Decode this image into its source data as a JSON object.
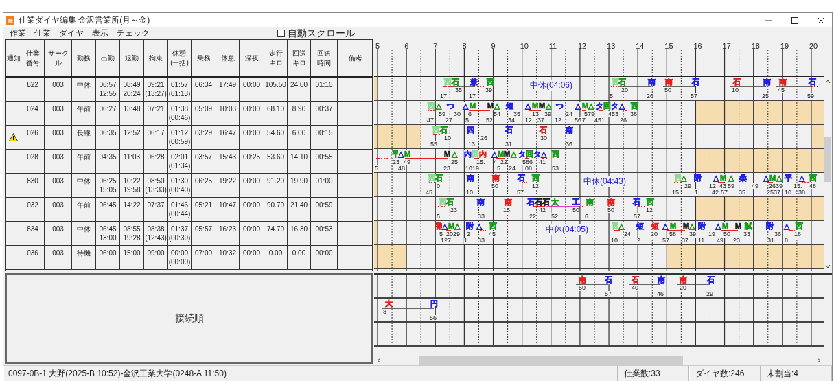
{
  "window": {
    "title": "仕業ダイヤ編集 金沢営業所(月～金)"
  },
  "menu": [
    "作業",
    "仕業",
    "ダイヤ",
    "表示",
    "チェック"
  ],
  "auto_scroll": {
    "label": "自動スクロール",
    "checked": false
  },
  "table": {
    "notice_column": "通知",
    "columns": [
      "仕業番号",
      "サークル",
      "勤務",
      "出勤",
      "退勤",
      "拘束",
      "休憩\n(一括)",
      "乗務",
      "休息",
      "深夜",
      "走行キロ",
      "回送キロ",
      "回送時間",
      "備考"
    ],
    "rows": [
      {
        "warning": false,
        "cells": [
          "822",
          "003",
          "中休",
          "06:57\n12:55",
          "08:49\n20:24",
          "09:21\n(13:27)",
          "01:57\n(01:13)",
          "06:34",
          "17:49",
          "00:00",
          "105.50",
          "24.00",
          "01:10"
        ]
      },
      {
        "warning": false,
        "cells": [
          "024",
          "003",
          "午前",
          "06:27",
          "13:48",
          "07:21",
          "01:38\n(00:46)",
          "05:09",
          "10:03",
          "00:00",
          "68.10",
          "8.90",
          "00:37"
        ]
      },
      {
        "warning": true,
        "cells": [
          "026",
          "003",
          "長線",
          "06:35",
          "12:52",
          "06:17",
          "01:12\n(00:59)",
          "03:29",
          "16:47",
          "00:00",
          "54.60",
          "6.00",
          "00:15"
        ]
      },
      {
        "warning": false,
        "cells": [
          "028",
          "003",
          "午前",
          "04:35",
          "11:03",
          "06:28",
          "02:01\n(01:34)",
          "03:57",
          "15:43",
          "00:25",
          "53.60",
          "14.10",
          "00:55"
        ]
      },
      {
        "warning": false,
        "cells": [
          "830",
          "003",
          "中休",
          "06:25\n15:05",
          "10:22\n19:58",
          "08:50\n(13:33)",
          "01:30\n(00:40)",
          "06:25",
          "19:22",
          "00:00",
          "91.20",
          "19.90",
          "01:00"
        ]
      },
      {
        "warning": false,
        "cells": [
          "032",
          "003",
          "午前",
          "06:45",
          "14:22",
          "07:37",
          "01:46\n(00:44)",
          "05:21",
          "10:47",
          "00:00",
          "90.70",
          "21.40",
          "00:59"
        ]
      },
      {
        "warning": false,
        "cells": [
          "834",
          "003",
          "中休",
          "06:45\n13:00",
          "08:55\n19:28",
          "08:38\n(12:43)",
          "01:37\n(00:39)",
          "05:57",
          "16:23",
          "00:00",
          "74.70",
          "16.30",
          "00:53"
        ]
      },
      {
        "warning": false,
        "cells": [
          "036",
          "003",
          "待機",
          "06:00",
          "15:00",
          "09:00",
          "00:00\n(00:00)",
          "07:00",
          "10:32",
          "00:00",
          "0.00",
          "0.00",
          "00:00"
        ]
      }
    ]
  },
  "timeline": {
    "hours": [
      "5",
      "6",
      "7",
      "8",
      "9",
      "10",
      "11",
      "12",
      "13",
      "14",
      "15",
      "16",
      "17",
      "18",
      "19",
      "20"
    ],
    "rows": [
      {
        "break_label": "中休(04:06)",
        "marks": [
          {
            "text": "西",
            "color": "#8fd88f"
          },
          {
            "text": "石",
            "color": "#1a9a1a"
          },
          {
            "text": "兼",
            "color": "#1f1fe0"
          },
          {
            "text": "西",
            "color": "#1a9a1a"
          },
          {
            "text": "西",
            "color": "#8fd88f"
          },
          {
            "text": "石",
            "color": "#1a9a1a"
          },
          {
            "text": "南",
            "color": "#1f1fe0"
          },
          {
            "text": "南",
            "color": "#e01f1f"
          },
          {
            "text": "石",
            "color": "#1f1fe0"
          },
          {
            "text": "石",
            "color": "#e01f1f"
          },
          {
            "text": "南",
            "color": "#1f1fe0"
          },
          {
            "text": "南",
            "color": "#e01f1f"
          },
          {
            "text": "石",
            "color": "#1f1fe0"
          }
        ],
        "numbers": [
          "35",
          "39",
          "20",
          "50",
          "10",
          "45"
        ],
        "numbers_lower": [
          "17",
          "17",
          "5",
          "26",
          "57",
          "25",
          "59"
        ]
      },
      {
        "marks": [
          {
            "text": "西",
            "color": "#8fd88f"
          },
          {
            "text": "△",
            "color": "#1a9a1a"
          },
          {
            "text": "つ",
            "color": "#1f1fe0"
          },
          {
            "text": "△",
            "color": "#1f1fe0"
          },
          {
            "text": "M",
            "color": "#1a9a1a"
          },
          {
            "text": "M",
            "color": "#202020"
          },
          {
            "text": "△",
            "color": "#1a9a1a"
          },
          {
            "text": "短",
            "color": "#1f1fe0"
          },
          {
            "text": "△",
            "color": "#1f1fe0"
          },
          {
            "text": "M",
            "color": "#1a9a1a"
          },
          {
            "text": "M",
            "color": "#202020"
          },
          {
            "text": "△",
            "color": "#1a9a1a"
          },
          {
            "text": "つ",
            "color": "#1f1fe0"
          },
          {
            "text": "△",
            "color": "#1f1fe0"
          },
          {
            "text": "M",
            "color": "#1a9a1a"
          },
          {
            "text": "△",
            "color": "#1a9a1a"
          },
          {
            "text": "タ",
            "color": "#1f1fe0"
          },
          {
            "text": "回",
            "color": "#1a9a1a"
          },
          {
            "text": "タ",
            "color": "#1f1fe0"
          },
          {
            "text": "△",
            "color": "#1f1fe0"
          },
          {
            "text": "西",
            "color": "#1a9a1a"
          }
        ],
        "numbers": [
          "59",
          "30",
          "6",
          "54",
          "35",
          "13",
          "39",
          "24",
          "579",
          "453",
          "38"
        ],
        "numbers_lower": [
          "47",
          "27",
          "5",
          "52",
          "34",
          "12",
          "37",
          "12",
          "56",
          "7",
          "451",
          "26"
        ]
      },
      {
        "marks": [
          {
            "text": "西",
            "color": "#8fd88f"
          },
          {
            "text": "石",
            "color": "#1a9a1a"
          },
          {
            "text": "四",
            "color": "#1f1fe0"
          },
          {
            "text": "石",
            "color": "#1f1fe0"
          },
          {
            "text": "石",
            "color": "#e01f1f"
          },
          {
            "text": "南",
            "color": "#1f1fe0"
          }
        ],
        "numbers": [
          "10",
          "26",
          "30"
        ],
        "numbers_lower": [
          "55",
          "13",
          "31",
          "36"
        ]
      },
      {
        "marks": [
          {
            "text": "平",
            "color": "#1a9a1a"
          },
          {
            "text": "△",
            "color": "#1f1fe0"
          },
          {
            "text": "M",
            "color": "#1a9a1a"
          },
          {
            "text": "M",
            "color": "#202020"
          },
          {
            "text": "△",
            "color": "#1a9a1a"
          },
          {
            "text": "内",
            "color": "#1f1fe0"
          },
          {
            "text": "回",
            "color": "#8fd88f"
          },
          {
            "text": "内",
            "color": "#e01f1f"
          },
          {
            "text": "△",
            "color": "#1f1fe0"
          },
          {
            "text": "M",
            "color": "#1a9a1a"
          },
          {
            "text": "M",
            "color": "#202020"
          },
          {
            "text": "△",
            "color": "#1a9a1a"
          },
          {
            "text": "タ",
            "color": "#1f1fe0"
          },
          {
            "text": "回",
            "color": "#1a9a1a"
          },
          {
            "text": "タ",
            "color": "#1f1fe0"
          },
          {
            "text": "△",
            "color": "#1f1fe0"
          },
          {
            "text": "西",
            "color": "#1a9a1a"
          }
        ],
        "numbers": [
          "23",
          "49",
          "25",
          "15:",
          "4",
          "22",
          "586",
          "41"
        ],
        "numbers_lower": [
          "5",
          "48",
          "23",
          "1019",
          "5",
          "24",
          "08",
          "53"
        ]
      },
      {
        "break_label": "中休(04:43)",
        "marks": [
          {
            "text": "西",
            "color": "#8fd88f"
          },
          {
            "text": "石",
            "color": "#1a9a1a"
          },
          {
            "text": "南",
            "color": "#1f1fe0"
          },
          {
            "text": "南",
            "color": "#e01f1f"
          },
          {
            "text": "石",
            "color": "#1f1fe0"
          },
          {
            "text": "西",
            "color": "#1a9a1a"
          },
          {
            "text": "西",
            "color": "#8fd88f"
          },
          {
            "text": "△",
            "color": "#1a9a1a"
          },
          {
            "text": "附",
            "color": "#1f1fe0"
          },
          {
            "text": "△",
            "color": "#1f1fe0"
          },
          {
            "text": "M",
            "color": "#1a9a1a"
          },
          {
            "text": "△",
            "color": "#1a9a1a"
          },
          {
            "text": "桑",
            "color": "#1f1fe0"
          },
          {
            "text": "△",
            "color": "#1f1fe0"
          },
          {
            "text": "M",
            "color": "#1a9a1a"
          },
          {
            "text": "△",
            "color": "#1a9a1a"
          },
          {
            "text": "平",
            "color": "#1f1fe0"
          },
          {
            "text": "△",
            "color": "#1f1fe0"
          },
          {
            "text": "西",
            "color": "#1a9a1a"
          }
        ],
        "numbers": [
          "0",
          "50",
          "12",
          "29",
          "12",
          "43",
          "59",
          "49",
          "2639",
          "15:",
          "48"
        ],
        "numbers_lower": [
          "45",
          "10",
          "57",
          "15",
          "1",
          "42",
          "57",
          "35",
          "2537",
          "10",
          "38"
        ]
      },
      {
        "marks": [
          {
            "text": "西",
            "color": "#8fd88f"
          },
          {
            "text": "石",
            "color": "#1a9a1a"
          },
          {
            "text": "南",
            "color": "#1f1fe0"
          },
          {
            "text": "南",
            "color": "#e01f1f"
          },
          {
            "text": "石",
            "color": "#1f1fe0"
          },
          {
            "text": "石",
            "color": "#202020"
          },
          {
            "text": "石",
            "color": "#202020"
          },
          {
            "text": "太",
            "color": "#1a9a1a"
          },
          {
            "text": "工",
            "color": "#1f1fe0"
          },
          {
            "text": "南",
            "color": "#1a9a1a"
          },
          {
            "text": "南",
            "color": "#e01f1f"
          },
          {
            "text": "石",
            "color": "#1f1fe0"
          },
          {
            "text": "西",
            "color": "#1a9a1a"
          }
        ],
        "numbers": [
          "23",
          "15:",
          "42",
          "50",
          "50",
          "12"
        ],
        "numbers_lower": [
          "5",
          "33",
          "22",
          "52",
          "6",
          "57"
        ]
      },
      {
        "break_label": "中休(04:05)",
        "marks": [
          {
            "text": "割",
            "color": "#e01f1f"
          },
          {
            "text": "△",
            "color": "#1f1fe0"
          },
          {
            "text": "M",
            "color": "#1a9a1a"
          },
          {
            "text": "△",
            "color": "#1a9a1a"
          },
          {
            "text": "附",
            "color": "#1f1fe0"
          },
          {
            "text": "△",
            "color": "#1f1fe0"
          },
          {
            "text": "西",
            "color": "#1a9a1a"
          },
          {
            "text": "西",
            "color": "#8fd88f"
          },
          {
            "text": "△",
            "color": "#1a9a1a"
          },
          {
            "text": "短",
            "color": "#1f1fe0"
          },
          {
            "text": "短",
            "color": "#e01f1f"
          },
          {
            "text": "△",
            "color": "#1f1fe0"
          },
          {
            "text": "M",
            "color": "#1a9a1a"
          },
          {
            "text": "M",
            "color": "#202020"
          },
          {
            "text": "△",
            "color": "#1a9a1a"
          },
          {
            "text": "附",
            "color": "#1f1fe0"
          },
          {
            "text": "△",
            "color": "#1f1fe0"
          },
          {
            "text": "M",
            "color": "#1a9a1a"
          },
          {
            "text": "M",
            "color": "#202020"
          },
          {
            "text": "試",
            "color": "#1a9a1a"
          },
          {
            "text": "附",
            "color": "#1f1fe0"
          },
          {
            "text": "△",
            "color": "#1f1fe0"
          },
          {
            "text": "西",
            "color": "#1a9a1a"
          }
        ],
        "numbers": [
          "5",
          "2029",
          "2",
          "45",
          "24",
          "20",
          "58",
          "39",
          "19",
          "50",
          "33",
          "36",
          "18"
        ],
        "numbers_lower": [
          "127",
          "1",
          "33",
          "10",
          "2",
          "57",
          "37",
          "11",
          "49",
          "23",
          "31",
          "8"
        ]
      },
      {
        "marks": [],
        "numbers": [],
        "numbers_lower": []
      }
    ]
  },
  "connection": {
    "label": "接続順",
    "rows": [
      {
        "marks": [
          {
            "text": "南",
            "color": "#e01f1f"
          },
          {
            "text": "石",
            "color": "#1f1fe0"
          },
          {
            "text": "石",
            "color": "#e01f1f"
          },
          {
            "text": "南",
            "color": "#1f1fe0"
          },
          {
            "text": "南",
            "color": "#e01f1f"
          },
          {
            "text": "石",
            "color": "#1f1fe0"
          }
        ],
        "numbers": [
          "50",
          "40",
          "20"
        ],
        "numbers_lower": [
          "57",
          "46",
          "29"
        ]
      },
      {
        "marks": [
          {
            "text": "大",
            "color": "#e01f1f"
          },
          {
            "text": "円",
            "color": "#1f1fe0"
          }
        ],
        "numbers": [
          "8"
        ],
        "numbers_lower": [
          "56"
        ]
      },
      {
        "marks": [],
        "numbers": [],
        "numbers_lower": []
      }
    ]
  },
  "status_bar": {
    "route": "0097-0B-1 大野(2025-B 10:52)-金沢工業大学(0248-A 11:50)",
    "counts": [
      "仕業数:33",
      "ダイヤ数:246",
      "未割当:4"
    ]
  }
}
